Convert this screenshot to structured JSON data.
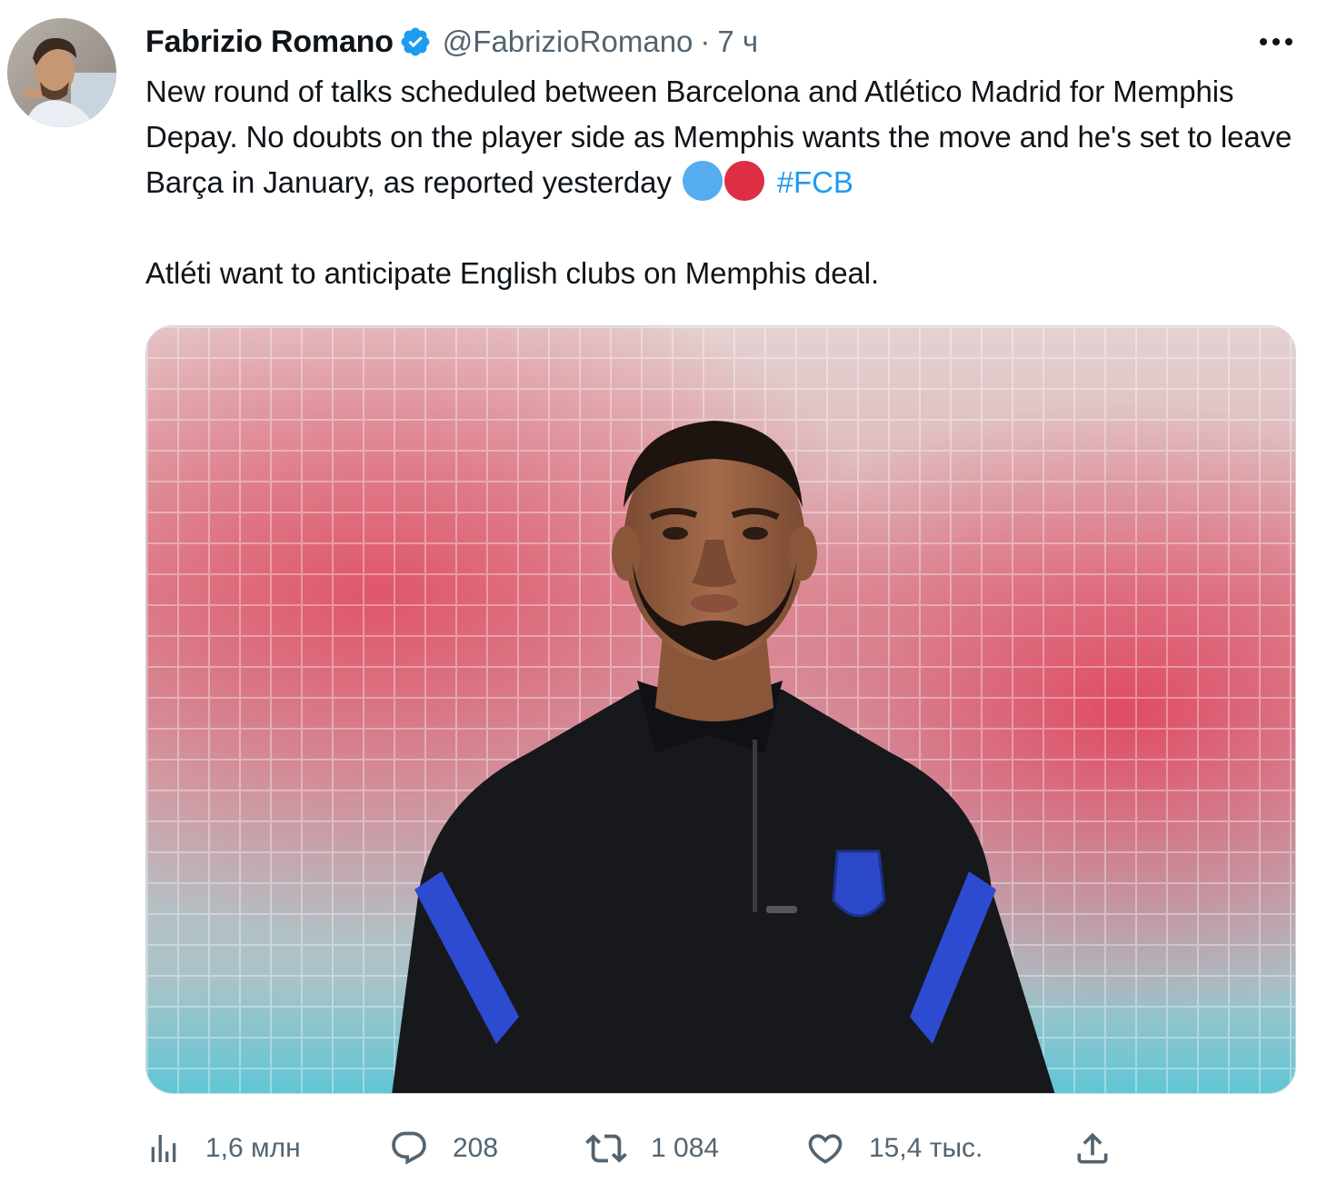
{
  "tweet": {
    "author": {
      "display_name": "Fabrizio Romano",
      "handle": "@FabrizioRomano",
      "verified": true,
      "avatar_icon": "profile-photo"
    },
    "separator": "·",
    "time": "7 ч",
    "more_icon": "more-horizontal-icon",
    "text": {
      "paragraph1": "New round of talks scheduled between Barcelona and Atlético Madrid for Memphis Depay. No doubts on the player side as Memphis wants the move and he's set to leave Barça in January, as reported yesterday",
      "emojis": [
        "blue-circle",
        "red-circle"
      ],
      "hashtag": "#FCB",
      "paragraph2": "Atléti want to anticipate English clubs on Memphis deal."
    },
    "media": {
      "type": "photo"
    },
    "stats": {
      "views": {
        "icon": "analytics-icon",
        "value": "1,6 млн"
      },
      "replies": {
        "icon": "reply-icon",
        "value": "208"
      },
      "retweets": {
        "icon": "retweet-icon",
        "value": "1 084"
      },
      "likes": {
        "icon": "heart-icon",
        "value": "15,4 тыс."
      },
      "share": {
        "icon": "share-icon"
      }
    }
  },
  "colors": {
    "accent": "#1d9bf0",
    "text_primary": "#0f1419",
    "text_secondary": "#536471"
  }
}
